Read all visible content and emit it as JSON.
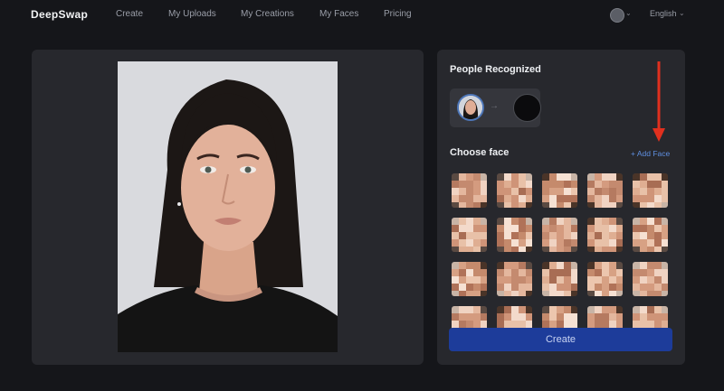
{
  "nav": {
    "logo": "DeepSwap",
    "links": [
      "Create",
      "My Uploads",
      "My Creations",
      "My Faces",
      "Pricing"
    ],
    "language": "English"
  },
  "right": {
    "people_title": "People Recognized",
    "choose_title": "Choose face",
    "add_face": "+ Add Face",
    "create": "Create"
  },
  "icons": {
    "user": "user-avatar-icon",
    "chevron": "chevron-down-icon",
    "arrow": "red-arrow-annotation-icon"
  },
  "colors": {
    "accent": "#5f8fe0",
    "create_button": "#1d3c9a",
    "annotation_arrow": "#e0301e"
  }
}
